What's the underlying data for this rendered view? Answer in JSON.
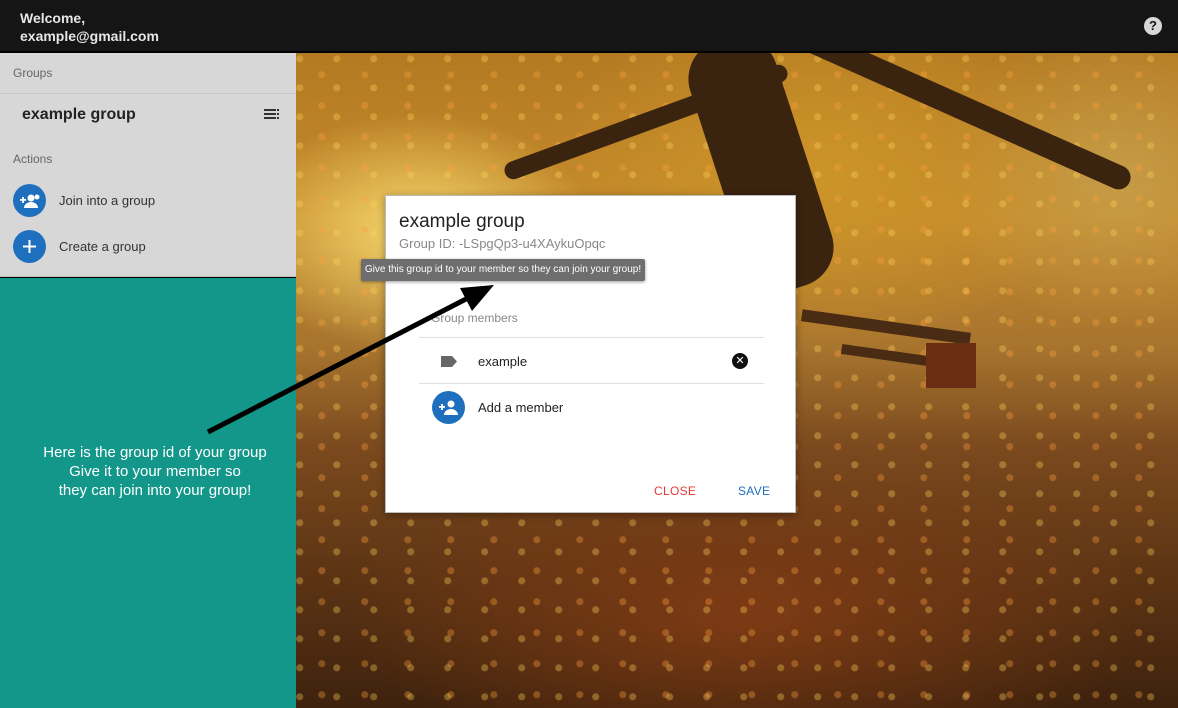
{
  "header": {
    "welcome_line1": "Welcome,",
    "welcome_line2": "example@gmail.com",
    "help_icon": "?"
  },
  "sidebar": {
    "groups_label": "Groups",
    "group_name": "example group",
    "actions_label": "Actions",
    "actions": [
      {
        "label": "Join into a group",
        "icon": "group-add-icon"
      },
      {
        "label": "Create a group",
        "icon": "plus-icon"
      }
    ]
  },
  "tutorial": {
    "line1": "Here is the group id of your group",
    "line2": "Give it to your member so",
    "line3": "they can join into your group!"
  },
  "dialog": {
    "title": "example group",
    "group_id": "Group ID: -LSpgQp3-u4XAykuOpqc",
    "tooltip": "Give this group id to your member so they can join your group!",
    "members_label": "Group members",
    "members": [
      {
        "name": "example"
      }
    ],
    "add_member_label": "Add a member",
    "close_label": "CLOSE",
    "save_label": "SAVE"
  },
  "colors": {
    "topbar": "#151515",
    "sidebar": "#d7d7d7",
    "teal": "#13978a",
    "accent_blue": "#1f6fbf",
    "close_red": "#e53935"
  }
}
